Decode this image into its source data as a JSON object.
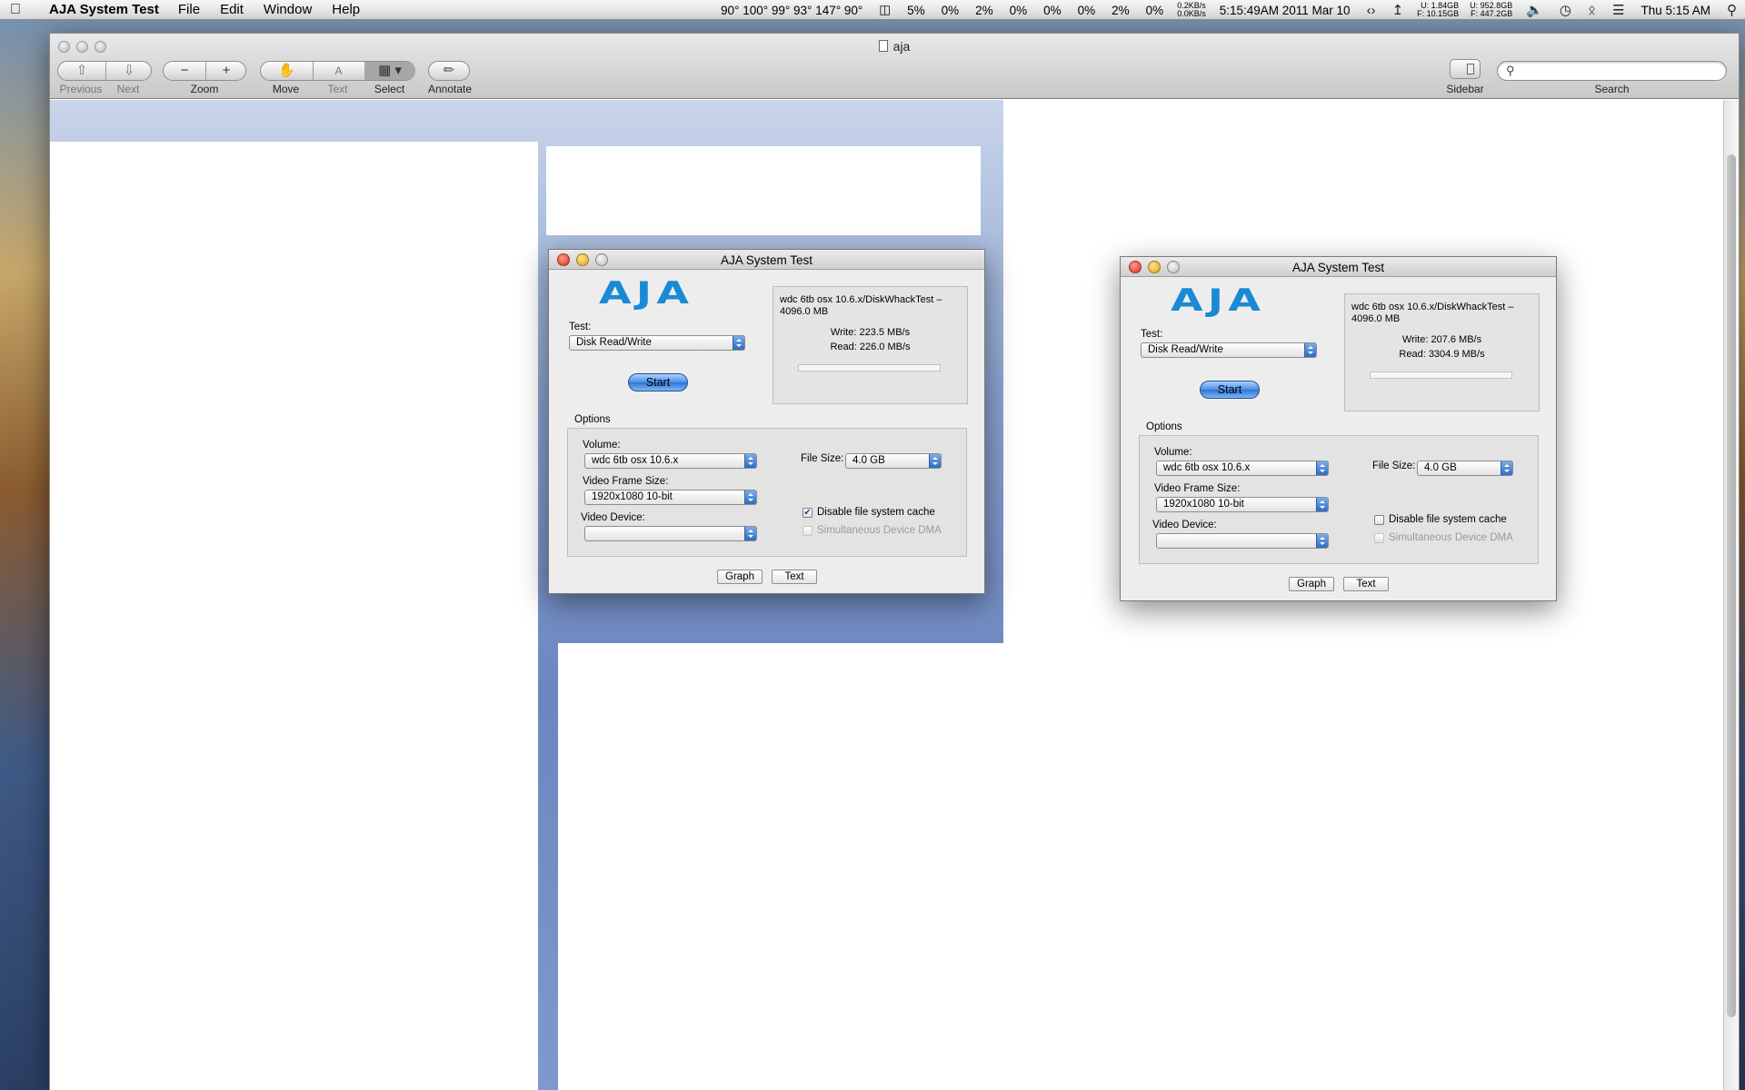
{
  "menubar": {
    "app_name": "AJA System Test",
    "menus": [
      "File",
      "Edit",
      "Window",
      "Help"
    ],
    "temps": "90° 100° 99° 93° 147° 90°",
    "cpu": [
      "5%",
      "0%",
      "2%",
      "0%",
      "0%",
      "0%",
      "2%",
      "0%"
    ],
    "net_up": "0.2KB/s",
    "net_down": "0.0KB/s",
    "clock_full": "5:15:49AM 2011 Mar 10",
    "mem_u": "U: 1.84GB",
    "mem_f": "F: 10.15GB",
    "disk_u": "U: 952.8GB",
    "disk_f": "F: 447.2GB",
    "time": "Thu 5:15 AM"
  },
  "preview": {
    "title": "aja",
    "toolbar": {
      "previous": "Previous",
      "next": "Next",
      "zoom": "Zoom",
      "move": "Move",
      "text": "Text",
      "select": "Select",
      "annotate": "Annotate",
      "sidebar": "Sidebar",
      "search": "Search"
    },
    "search_value": ""
  },
  "aja_left": {
    "title": "AJA System Test",
    "logo": "AJA",
    "test_label": "Test:",
    "test_value": "Disk Read/Write",
    "start": "Start",
    "result_path": "wdc 6tb osx 10.6.x/DiskWhackTest – 4096.0 MB",
    "write": "Write: 223.5 MB/s",
    "read": "Read: 226.0 MB/s",
    "progress": 0,
    "options_label": "Options",
    "volume_label": "Volume:",
    "volume_value": "wdc 6tb osx 10.6.x",
    "file_size_label": "File Size:",
    "file_size_value": "4.0 GB",
    "frame_label": "Video Frame Size:",
    "frame_value": "1920x1080 10-bit",
    "device_label": "Video Device:",
    "device_value": "",
    "cache_label": "Disable file system cache",
    "cache_checked": true,
    "dma_label": "Simultaneous Device DMA",
    "graph": "Graph",
    "text": "Text"
  },
  "aja_right": {
    "title": "AJA System Test",
    "logo": "AJA",
    "test_label": "Test:",
    "test_value": "Disk Read/Write",
    "start": "Start",
    "result_path": "wdc 6tb osx 10.6.x/DiskWhackTest – 4096.0 MB",
    "write": "Write: 207.6 MB/s",
    "read": "Read: 3304.9 MB/s",
    "progress": 0,
    "options_label": "Options",
    "volume_label": "Volume:",
    "volume_value": "wdc 6tb osx 10.6.x",
    "file_size_label": "File Size:",
    "file_size_value": "4.0 GB",
    "frame_label": "Video Frame Size:",
    "frame_value": "1920x1080 10-bit",
    "device_label": "Video Device:",
    "device_value": "",
    "cache_label": "Disable file system cache",
    "cache_checked": false,
    "dma_label": "Simultaneous Device DMA",
    "graph": "Graph",
    "text": "Text"
  }
}
